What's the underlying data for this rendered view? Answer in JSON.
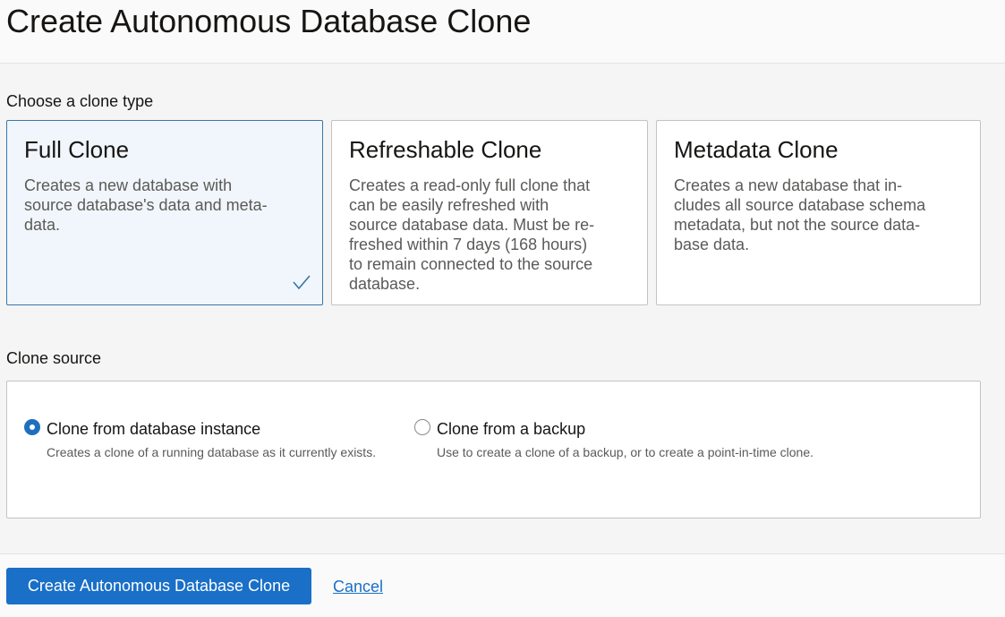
{
  "header": {
    "title": "Create Autonomous Database Clone"
  },
  "clone_type": {
    "label": "Choose a clone type",
    "selected": "full",
    "cards": [
      {
        "title": "Full Clone",
        "description": "Creates a new database with\nsource database's data and meta-\ndata."
      },
      {
        "title": "Refreshable Clone",
        "description": "Creates a read-only full clone that\ncan be easily refreshed with\nsource database data. Must be re-\nfreshed within 7 days (168 hours)\nto remain connected to the source\ndatabase."
      },
      {
        "title": "Metadata Clone",
        "description": "Creates a new database that in-\ncludes all source database schema\nmetadata, but not the source data-\nbase data."
      }
    ]
  },
  "clone_source": {
    "label": "Clone source",
    "options": [
      {
        "label": "Clone from database instance",
        "description": "Creates a clone of a running database as it currently exists.",
        "checked": true
      },
      {
        "label": "Clone from a backup",
        "description": "Use to create a clone of a backup, or to create a point-in-time clone.",
        "checked": false
      }
    ]
  },
  "footer": {
    "create_label": "Create Autonomous Database Clone",
    "cancel_label": "Cancel"
  },
  "colors": {
    "accent": "#1a6fc7",
    "selected_border": "#3a76a8",
    "selected_bg": "#f0f6fb"
  }
}
